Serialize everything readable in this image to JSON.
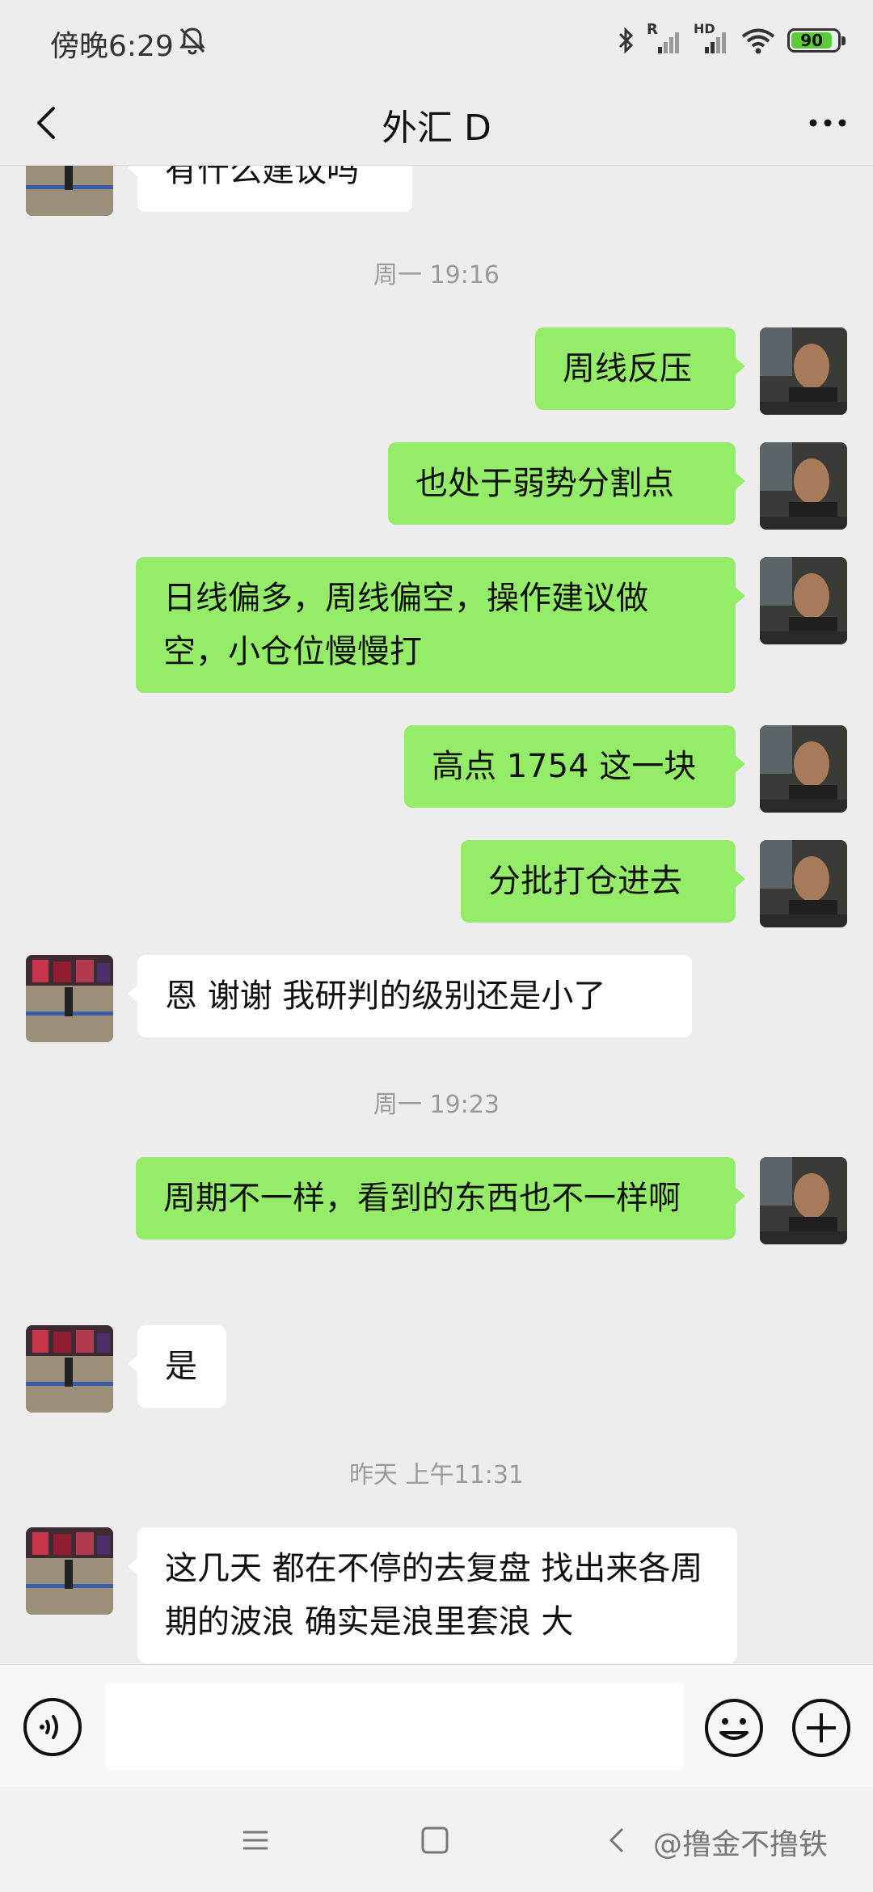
{
  "status_bar": {
    "time": "傍晚6:29",
    "signal_labels": [
      "R",
      "HD"
    ],
    "battery": "90"
  },
  "header": {
    "title": "外汇 D"
  },
  "messages": [
    {
      "type": "in",
      "text": "有什么建议吗"
    },
    {
      "type": "time",
      "text": "周一 19:16"
    },
    {
      "type": "out",
      "text": "周线反压"
    },
    {
      "type": "out",
      "text": "也处于弱势分割点"
    },
    {
      "type": "out",
      "text": "日线偏多，周线偏空，操作建议做空，小仓位慢慢打"
    },
    {
      "type": "out",
      "text": "高点 1754 这一块"
    },
    {
      "type": "out",
      "text": "分批打仓进去"
    },
    {
      "type": "in",
      "text": "恩 谢谢 我研判的级别还是小了"
    },
    {
      "type": "time",
      "text": "周一 19:23"
    },
    {
      "type": "out",
      "text": "周期不一样，看到的东西也不一样啊"
    },
    {
      "type": "in",
      "text": "是"
    },
    {
      "type": "time",
      "text": "昨天 上午11:31"
    },
    {
      "type": "in",
      "text": "这几天 都在不停的去复盘 找出来各周期的波浪 确实是浪里套浪 大"
    }
  ],
  "input": {
    "value": "",
    "placeholder": ""
  },
  "icons": {
    "back": "back-arrow-icon",
    "more": "more-dots-icon",
    "voice": "voice-icon",
    "emoji": "emoji-icon",
    "plus": "plus-icon",
    "silent": "bell-off-icon",
    "bluetooth": "bluetooth-icon",
    "wifi": "wifi-icon"
  },
  "watermark": "@撸金不撸铁",
  "colors": {
    "background": "#ededed",
    "outgoing_bubble": "#95ec69",
    "incoming_bubble": "#ffffff",
    "battery": "#5ccb3a"
  }
}
